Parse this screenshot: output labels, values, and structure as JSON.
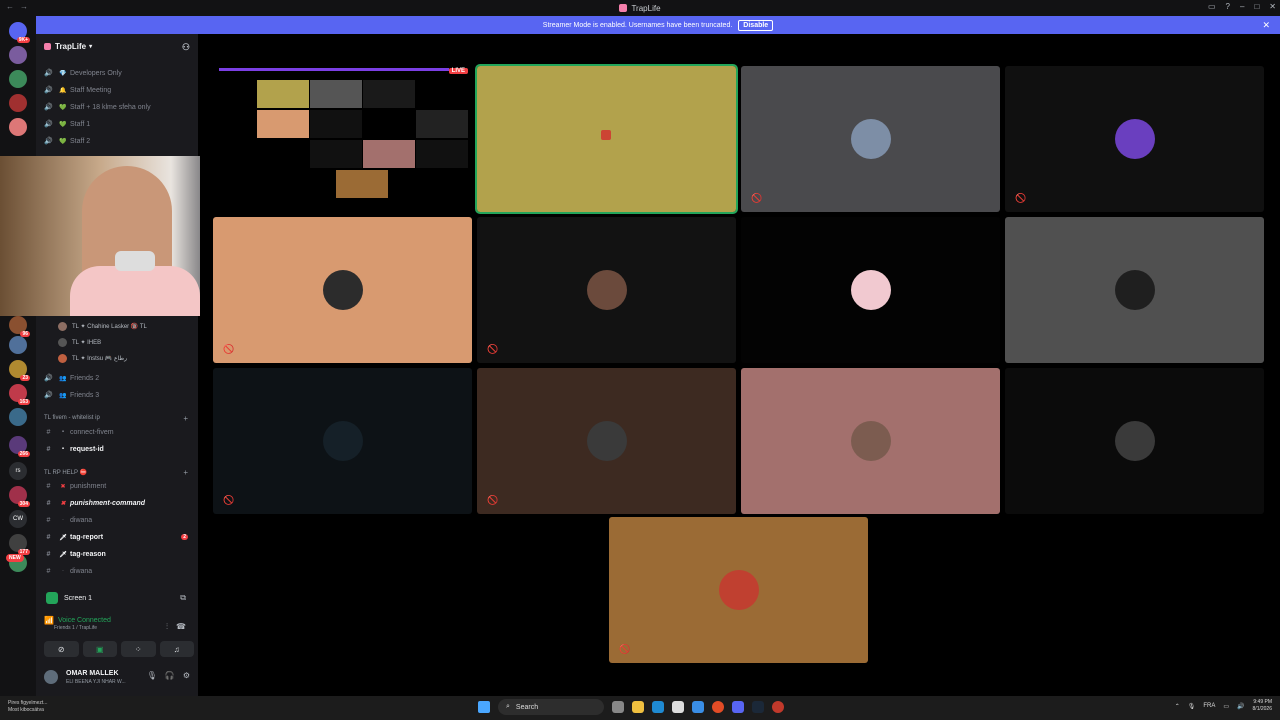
{
  "window": {
    "title": "TrapLife"
  },
  "banner": {
    "text": "Streamer Mode is enabled. Usernames have been truncated.",
    "button": "Disable"
  },
  "guild": {
    "name": "TrapLife"
  },
  "servers": [
    {
      "label": "",
      "badge": "9K+",
      "color": "#5865f2"
    },
    {
      "label": "",
      "badge": "",
      "color": "#7a5c9e"
    },
    {
      "label": "",
      "badge": "",
      "color": "#3c8a5a"
    },
    {
      "label": "",
      "badge": "",
      "color": "#a03030"
    },
    {
      "label": "",
      "badge": "",
      "color": "#d77"
    },
    {
      "label": "",
      "badge": "96",
      "color": "#8a5030"
    },
    {
      "label": "",
      "badge": "",
      "color": "#50709a"
    },
    {
      "label": "",
      "badge": "23",
      "color": "#b08a30"
    },
    {
      "label": "",
      "badge": "163",
      "color": "#c03a4a"
    },
    {
      "label": "",
      "badge": "",
      "color": "#3a6a8a"
    },
    {
      "label": "",
      "badge": "266",
      "color": "#5a3a7a"
    },
    {
      "label": "rs",
      "badge": "",
      "color": "#2b2d31"
    },
    {
      "label": "",
      "badge": "304",
      "color": "#a0304a"
    },
    {
      "label": "CW",
      "badge": "",
      "color": "#2b2d31"
    },
    {
      "label": "",
      "badge": "177",
      "color": "#404040"
    },
    {
      "label": "",
      "badge": "",
      "color": "#3c8a5a"
    }
  ],
  "new_badge": "NEW",
  "channels_top": [
    {
      "emoji": "💎",
      "name": "Developers Only"
    },
    {
      "emoji": "🔔",
      "name": "Staff Meeting"
    },
    {
      "emoji": "💚",
      "name": "Staff + 18 klme sfeha only"
    },
    {
      "emoji": "💚",
      "name": "Staff 1"
    },
    {
      "emoji": "💚",
      "name": "Staff 2"
    }
  ],
  "members": [
    {
      "name": "TL ✦ Chahine Lasker 🔞 TL"
    },
    {
      "name": "TL ✦ IHEB"
    },
    {
      "name": "TL ✦ Instsu 🎮 رطاع"
    }
  ],
  "channels_mid": [
    {
      "name": "Friends 2"
    },
    {
      "name": "Friends 3"
    }
  ],
  "cat_fivem": "TL fivem - whitelist ip",
  "channels_fivem": [
    {
      "name": "connect-fivem",
      "bold": false
    },
    {
      "name": "request-id",
      "bold": true
    }
  ],
  "cat_help": "TL RP HELP ⛔",
  "channels_help": [
    {
      "name": "punishment",
      "style": "normal"
    },
    {
      "name": "punishment-command",
      "style": "italic"
    },
    {
      "name": "diwana",
      "style": "normal"
    },
    {
      "name": "tag-report",
      "style": "bold",
      "mention": "2"
    },
    {
      "name": "tag-reason",
      "style": "bold"
    },
    {
      "name": "diwana",
      "style": "normal"
    }
  ],
  "screen": {
    "label": "Screen 1"
  },
  "voice": {
    "status": "Voice Connected",
    "channel": "Friends 1 / TrapLife"
  },
  "user": {
    "name": "OMAR MALLEK",
    "status": "ELI BEENA YJI NHAR W..."
  },
  "stream": {
    "live": "LIVE"
  },
  "tiles": [
    {
      "bg": "#000000",
      "type": "stream",
      "mute": false
    },
    {
      "bg": "#b2a24c",
      "type": "game",
      "mute": false,
      "highlight": true
    },
    {
      "bg": "#4a4a4d",
      "avatar": "#7d8ea6",
      "mute": true
    },
    {
      "bg": "#101010",
      "avatar": "#6a3fbf",
      "mute": true
    },
    {
      "bg": "#d89a70",
      "avatar": "#2c2c2c",
      "mute": true
    },
    {
      "bg": "#121212",
      "avatar": "#6b4a3c",
      "mute": true
    },
    {
      "bg": "#030303",
      "avatar": "#f1c9d0",
      "mute": false
    },
    {
      "bg": "#505050",
      "avatar": "#1f1f1f",
      "mute": false
    },
    {
      "bg": "#0d1216",
      "avatar": "#152028",
      "mute": true
    },
    {
      "bg": "#3d2a21",
      "avatar": "#3a3a3a",
      "mute": true
    },
    {
      "bg": "#a3706d",
      "avatar": "#7c5c50",
      "mute": false
    },
    {
      "bg": "#0b0b0b",
      "avatar": "#3a3a3a",
      "mute": false
    },
    {
      "bg": "#9b6b35",
      "avatar": "#c04030",
      "mute": true
    }
  ],
  "taskbar": {
    "weather_line1": "Pires figyelmezt...",
    "weather_line2": "Most kibocsátva",
    "search": "Search",
    "lang": "FRA",
    "time": "9:49 PM",
    "date": "8/1/2026"
  },
  "colors": {
    "accent": "#5865f2",
    "green": "#23a55a",
    "red": "#f23f43"
  }
}
